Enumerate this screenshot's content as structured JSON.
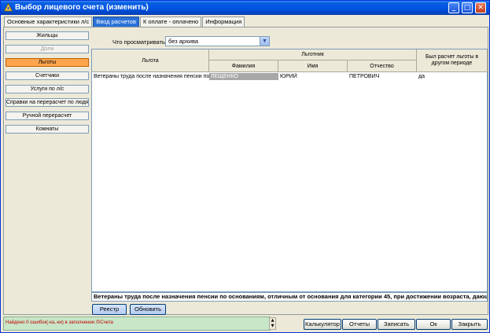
{
  "window": {
    "title": "Выбор лицевого счета (изменить)",
    "minimize": "_",
    "maximize": "□",
    "close": "✕"
  },
  "tabs": [
    {
      "label": "Основные характеристики л/с",
      "active": false
    },
    {
      "label": "Ввод расчетов",
      "active": true
    },
    {
      "label": "К оплате - оплачено",
      "active": false
    },
    {
      "label": "Информация",
      "active": false
    }
  ],
  "sidebar": {
    "items": [
      {
        "label": "Жильцы",
        "state": "normal"
      },
      {
        "label": "Доли",
        "state": "disabled"
      },
      {
        "label": "Льготы",
        "state": "active"
      },
      {
        "label": "Счетчики",
        "state": "normal"
      },
      {
        "label": "Услуги по л/с",
        "state": "normal"
      },
      {
        "label": "Справки на перерасчет по людям",
        "state": "normal"
      },
      {
        "label": "Ручной перерасчет",
        "state": "normal"
      },
      {
        "label": "Комнаты",
        "state": "normal"
      }
    ]
  },
  "filter": {
    "label": "Что просматривать",
    "value": "без архива",
    "dropdown_glyph": "▼"
  },
  "grid": {
    "headers": {
      "benefit": "Льгота",
      "beneficiary": "Льготник",
      "last_name": "Фамилия",
      "first_name": "Имя",
      "patronymic": "Отчество",
      "other_period": "Был расчет льготы в другом периоде"
    },
    "rows": [
      {
        "benefit": "Ветераны труда после назначения пенсии по о",
        "last_name": "ЛЕЩЕНКО",
        "first_name": "ЮРИЙ",
        "patronymic": "ПЕТРОВИЧ",
        "other_period": "да"
      }
    ]
  },
  "status_line": "Ветераны труда после назначения пенсии по основаниям, отличным от основания для категории 45, при достижении возраста, дающ",
  "actions": {
    "registry": "Реестр",
    "refresh": "Обновить"
  },
  "statusbar": {
    "message": "Найдено 0 ошибок(-ка,-ки) в заполнении Л/Счета"
  },
  "footer": {
    "calculator": "Калькулятор",
    "reports": "Отчеты",
    "save": "Записать",
    "ok": "Ок",
    "close": "Закрыть"
  },
  "colors": {
    "titlebar": "#0055e5",
    "active_tab": "#2b71d8",
    "active_sidebar": "#ffa54f",
    "statusbar_bg": "#c8e6c8",
    "error_text": "#c00000"
  }
}
